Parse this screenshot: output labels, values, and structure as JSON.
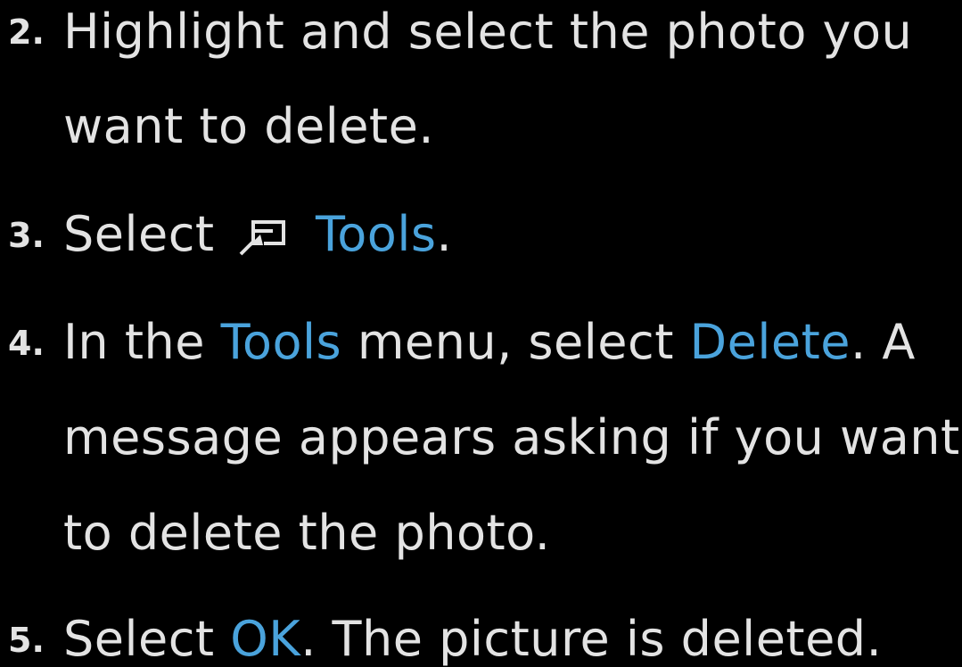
{
  "colors": {
    "background": "#000000",
    "text": "#e3e3e3",
    "highlight": "#4aa3dc"
  },
  "steps": [
    {
      "number": "2.",
      "lines": [
        "Highlight and select the photo you",
        "want to delete."
      ]
    },
    {
      "number": "3.",
      "select": "Select",
      "icon": "tools-remote-button-icon",
      "tools": "Tools",
      "period": "."
    },
    {
      "number": "4.",
      "part1": "In the",
      "tools": "Tools",
      "part2": "menu, select",
      "delete": "Delete",
      "part3": ". A",
      "line2": "message appears asking if you want",
      "line3": "to delete the photo."
    },
    {
      "number": "5.",
      "select": "Select",
      "ok": "OK",
      "rest": ". The picture is deleted."
    }
  ]
}
